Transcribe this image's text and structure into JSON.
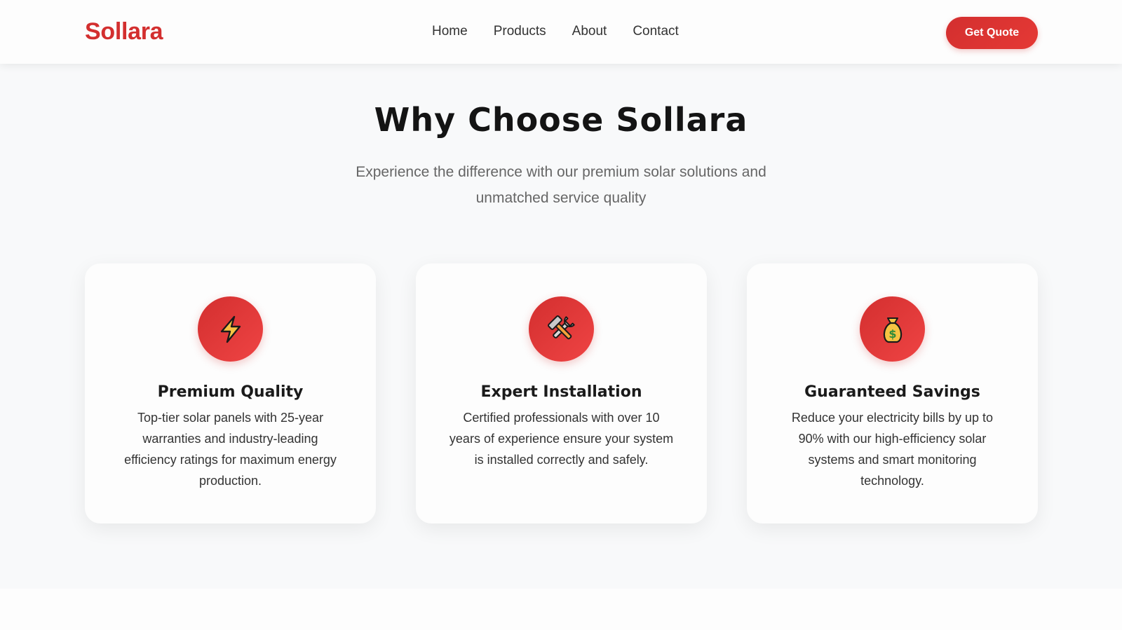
{
  "header": {
    "logo": "Sollara",
    "nav": [
      "Home",
      "Products",
      "About",
      "Contact"
    ],
    "cta_label": "Get Quote"
  },
  "section": {
    "title": "Why Choose Sollara",
    "subtitle": "Experience the difference with our premium solar solutions and unmatched service quality"
  },
  "features": [
    {
      "icon": "lightning-icon",
      "title": "Premium Quality",
      "text": "Top-tier solar panels with 25-year warranties and industry-leading efficiency ratings for maximum energy production."
    },
    {
      "icon": "tools-icon",
      "title": "Expert Installation",
      "text": "Certified professionals with over 10 years of experience ensure your system is installed correctly and safely."
    },
    {
      "icon": "money-bag-icon",
      "title": "Guaranteed Savings",
      "text": "Reduce your electricity bills by up to 90% with our high-efficiency solar systems and smart monitoring technology."
    }
  ],
  "colors": {
    "brand": "#d32f2f",
    "background": "#f8f9fa",
    "card": "#fdfdfd"
  }
}
